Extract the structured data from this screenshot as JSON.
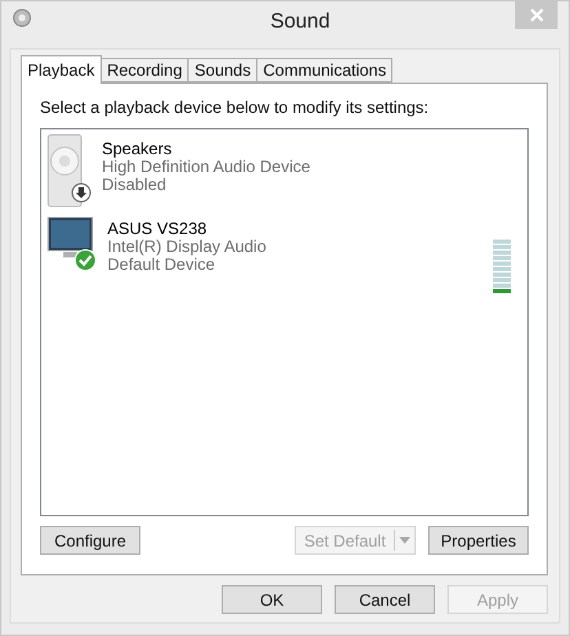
{
  "window": {
    "title": "Sound"
  },
  "tabs": [
    {
      "label": "Playback",
      "selected": true
    },
    {
      "label": "Recording",
      "selected": false
    },
    {
      "label": "Sounds",
      "selected": false
    },
    {
      "label": "Communications",
      "selected": false
    }
  ],
  "instruction": "Select a playback device below to modify its settings:",
  "devices": [
    {
      "kind": "speaker",
      "enabled": false,
      "default": false,
      "name": "Speakers",
      "driver": "High Definition Audio Device",
      "status": "Disabled"
    },
    {
      "kind": "monitor",
      "enabled": true,
      "default": true,
      "name": "ASUS VS238",
      "driver": "Intel(R) Display Audio",
      "status": "Default Device",
      "meter": {
        "level": 0.1
      }
    }
  ],
  "panel_buttons": [
    {
      "label": "Configure",
      "disabled": false
    },
    {
      "label": "Set Default",
      "disabled": true,
      "split": true
    },
    {
      "label": "Properties",
      "disabled": false
    }
  ],
  "dialog_buttons": [
    {
      "label": "OK",
      "disabled": false
    },
    {
      "label": "Cancel",
      "disabled": false
    },
    {
      "label": "Apply",
      "disabled": true
    }
  ]
}
